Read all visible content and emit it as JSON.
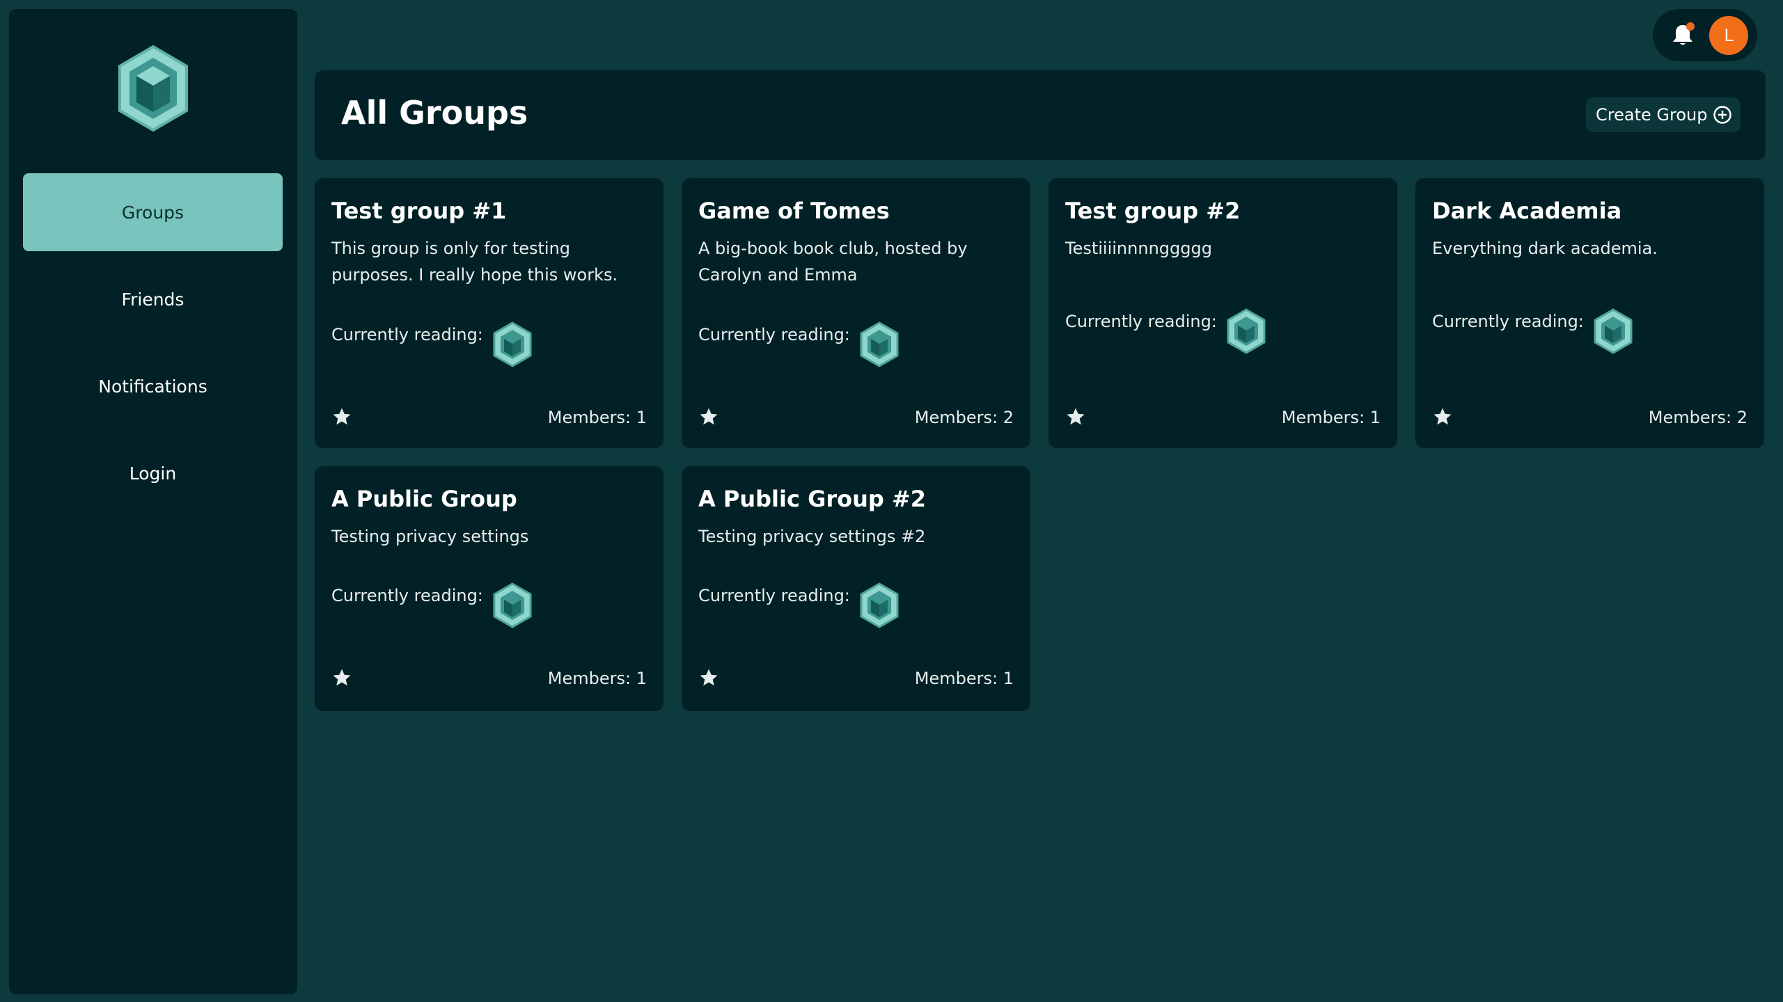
{
  "nav": {
    "items": [
      {
        "label": "Groups",
        "active": true
      },
      {
        "label": "Friends",
        "active": false
      },
      {
        "label": "Notifications",
        "active": false
      },
      {
        "label": "Login",
        "active": false
      }
    ]
  },
  "topbar": {
    "avatar_initial": "L",
    "notification_indicator": true
  },
  "header": {
    "title": "All Groups",
    "create_button_label": "Create Group"
  },
  "groups": [
    {
      "title": "Test group #1",
      "description": "This group is only for testing purposes. I really hope this works.",
      "reading_label": "Currently reading:",
      "members_label": "Members: 1"
    },
    {
      "title": "Game of Tomes",
      "description": "A big-book book club, hosted by Carolyn and Emma",
      "reading_label": "Currently reading:",
      "members_label": "Members: 2"
    },
    {
      "title": "Test group #2",
      "description": "Testiiiinnnnggggg",
      "reading_label": "Currently reading:",
      "members_label": "Members: 1"
    },
    {
      "title": "Dark Academia",
      "description": "Everything dark academia.",
      "reading_label": "Currently reading:",
      "members_label": "Members: 2"
    },
    {
      "title": "A Public Group",
      "description": "Testing privacy settings",
      "reading_label": "Currently reading:",
      "members_label": "Members: 1"
    },
    {
      "title": "A Public Group #2",
      "description": "Testing privacy settings #2",
      "reading_label": "Currently reading:",
      "members_label": "Members: 1"
    }
  ],
  "colors": {
    "page_bg": "#0d3a3c",
    "panel_bg": "#012126",
    "accent": "#79c4bc",
    "avatar": "#f26f1a"
  },
  "icons": {
    "logo": "hexagon-book-logo",
    "bell": "bell-icon",
    "plus": "plus-circle-icon",
    "star": "star-icon",
    "book": "hexagon-book-icon"
  }
}
